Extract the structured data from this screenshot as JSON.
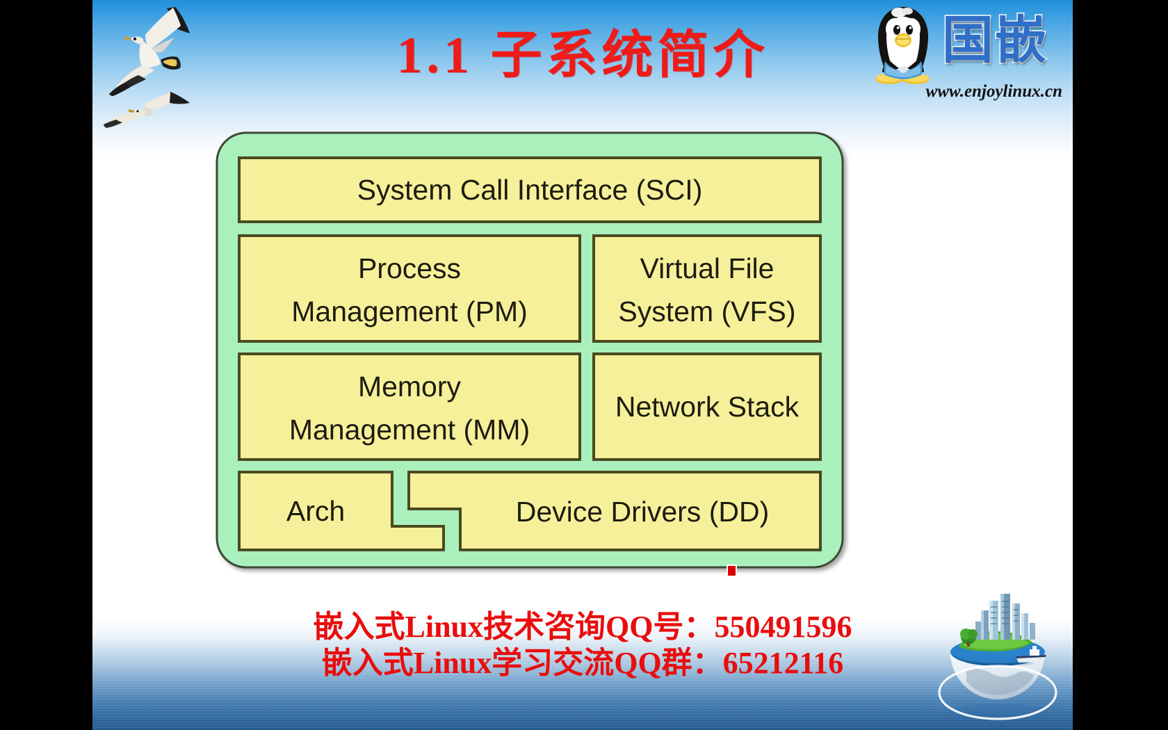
{
  "slide": {
    "title": "1.1 子系统简介",
    "title_color": "#ef1b18"
  },
  "brand": {
    "logo_icon": "tux-penguin-icon",
    "name_cn": "国嵌",
    "name_color": "#2f6fc8",
    "url": "www.enjoylinux.cn"
  },
  "decorations": {
    "seagull_icon": "seagull-icon",
    "globe_icon": "globe-city-icon",
    "marker_color": "#d60000"
  },
  "diagram": {
    "container_fill": "#aaf0bd",
    "box_fill": "#f6f09a",
    "box_stroke": "#4a4a20",
    "boxes": [
      {
        "id": "sci",
        "label": "System Call Interface (SCI)"
      },
      {
        "id": "pm",
        "label_line1": "Process",
        "label_line2": "Management (PM)"
      },
      {
        "id": "vfs",
        "label_line1": "Virtual File",
        "label_line2": "System (VFS)"
      },
      {
        "id": "mm",
        "label_line1": "Memory",
        "label_line2": "Management (MM)"
      },
      {
        "id": "net",
        "label": "Network Stack"
      },
      {
        "id": "arch",
        "label": "Arch"
      },
      {
        "id": "dd",
        "label": "Device Drivers (DD)"
      }
    ]
  },
  "footer": {
    "line1": "嵌入式Linux技术咨询QQ号：550491596",
    "line2": "嵌入式Linux学习交流QQ群：65212116",
    "color": "#ea0d0d"
  }
}
